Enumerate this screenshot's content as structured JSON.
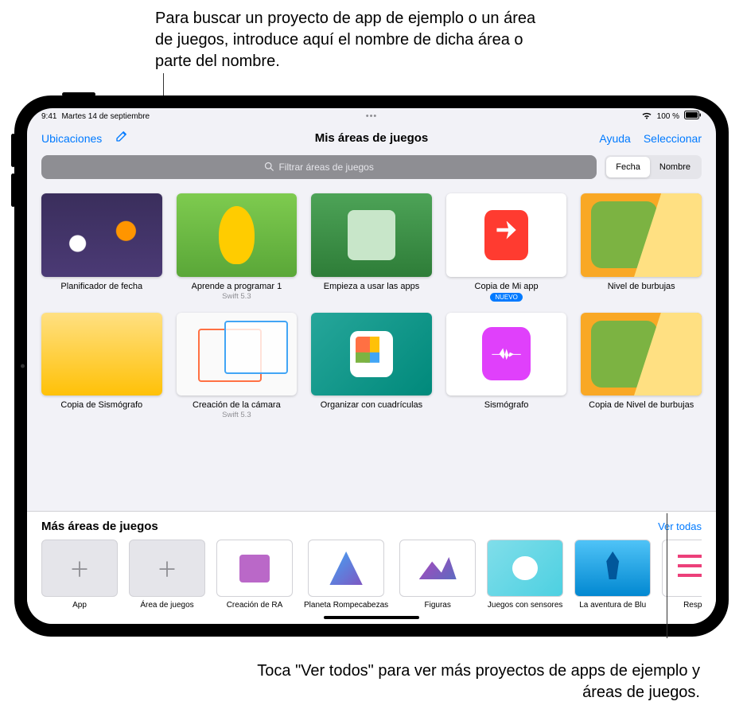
{
  "callouts": {
    "top": "Para buscar un proyecto de app de ejemplo o un área de juegos, introduce aquí el nombre de dicha área o parte del nombre.",
    "bottom": "Toca \"Ver todos\" para ver más proyectos de apps de ejemplo y áreas de juegos."
  },
  "statusbar": {
    "time": "9:41",
    "date": "Martes 14 de septiembre",
    "battery": "100 %",
    "battery_icon": "battery-full",
    "wifi_icon": "wifi"
  },
  "nav": {
    "back": "Ubicaciones",
    "compose_icon": "compose",
    "title": "Mis áreas de juegos",
    "help": "Ayuda",
    "select": "Seleccionar"
  },
  "search": {
    "placeholder": "Filtrar áreas de juegos",
    "icon": "search"
  },
  "sort": {
    "options": [
      "Fecha",
      "Nombre"
    ],
    "active": "Fecha"
  },
  "playgrounds": [
    {
      "title": "Planificador de fecha",
      "sub": "",
      "badge": "",
      "thumb": "th-planner"
    },
    {
      "title": "Aprende a programar 1",
      "sub": "Swift 5.3",
      "badge": "",
      "thumb": "th-learn"
    },
    {
      "title": "Empieza a usar las apps",
      "sub": "",
      "badge": "",
      "thumb": "th-apps"
    },
    {
      "title": "Copia de Mi app",
      "sub": "",
      "badge": "NUEVO",
      "thumb": "th-myapp"
    },
    {
      "title": "Nivel de burbujas",
      "sub": "",
      "badge": "",
      "thumb": "th-bubble"
    },
    {
      "title": "Copia de Sismógrafo",
      "sub": "",
      "badge": "",
      "thumb": "th-seismo-copy"
    },
    {
      "title": "Creación de la cámara",
      "sub": "Swift 5.3",
      "badge": "",
      "thumb": "th-camera"
    },
    {
      "title": "Organizar con cuadrículas",
      "sub": "",
      "badge": "",
      "thumb": "th-grid"
    },
    {
      "title": "Sismógrafo",
      "sub": "",
      "badge": "",
      "thumb": "th-seismo-plain"
    },
    {
      "title": "Copia de Nivel de burbujas",
      "sub": "",
      "badge": "",
      "thumb": "th-bubble"
    }
  ],
  "more": {
    "title": "Más áreas de juegos",
    "see_all": "Ver todas",
    "items": [
      {
        "label": "App",
        "create": true
      },
      {
        "label": "Área de juegos",
        "create": true
      },
      {
        "label": "Creación de RA",
        "thumb": "mth-ra"
      },
      {
        "label": "Planeta Rompecabezas",
        "thumb": "mth-planeta"
      },
      {
        "label": "Figuras",
        "thumb": "mth-figuras"
      },
      {
        "label": "Juegos con sensores",
        "thumb": "mth-sensores"
      },
      {
        "label": "La aventura de Blu",
        "thumb": "mth-blu"
      },
      {
        "label": "Respuest",
        "thumb": "mth-respuesta"
      }
    ]
  }
}
